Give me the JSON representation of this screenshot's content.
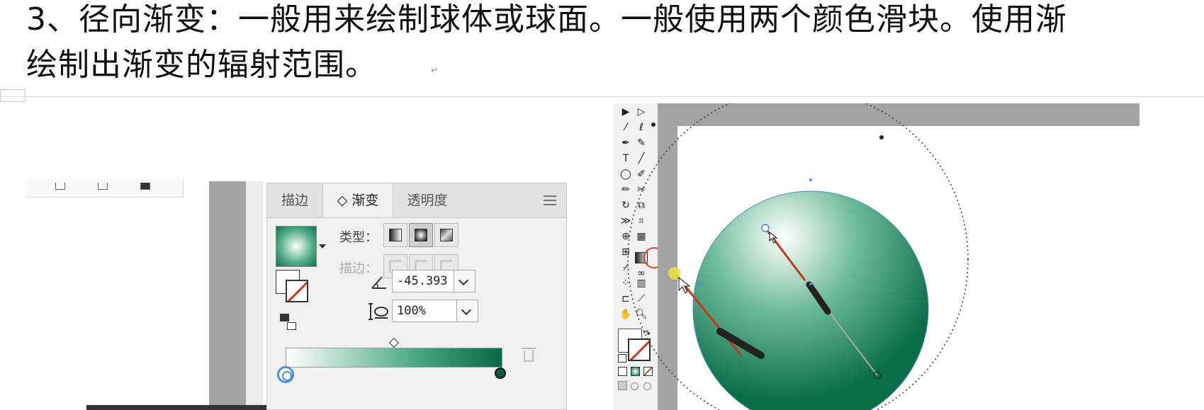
{
  "document": {
    "line1": "3、径向渐变：一般用来绘制球体或球面。一般使用两个颜色滑块。使用渐",
    "line2": "绘制出渐变的辐射范围。",
    "paragraph_mark": "↵"
  },
  "gradient_panel": {
    "tabs": [
      {
        "label": "描边",
        "active": false
      },
      {
        "label": "◇ 渐变",
        "active": true
      },
      {
        "label": "透明度",
        "active": false
      }
    ],
    "type_label": "类型：",
    "stroke_label": "描边：",
    "angle_value": "-45.393",
    "aspect_value": "100%",
    "type_options": [
      "linear-gradient-icon",
      "radial-gradient-icon",
      "freeform-gradient-icon"
    ],
    "selected_type": "radial",
    "gradient_start_color": "#ffffff",
    "gradient_end_color": "#0a6a45"
  },
  "canvas": {
    "sphere_highlight_color": "#ffffff",
    "sphere_mid_color": "#5bb08f",
    "sphere_edge_color": "#0e7150",
    "highlighted_tool": "gradient-tool-icon"
  },
  "colors": {
    "accent_red": "#d9482b",
    "panel_bg": "#f0f0f0",
    "pasteboard_gray": "#a3a3a3"
  }
}
